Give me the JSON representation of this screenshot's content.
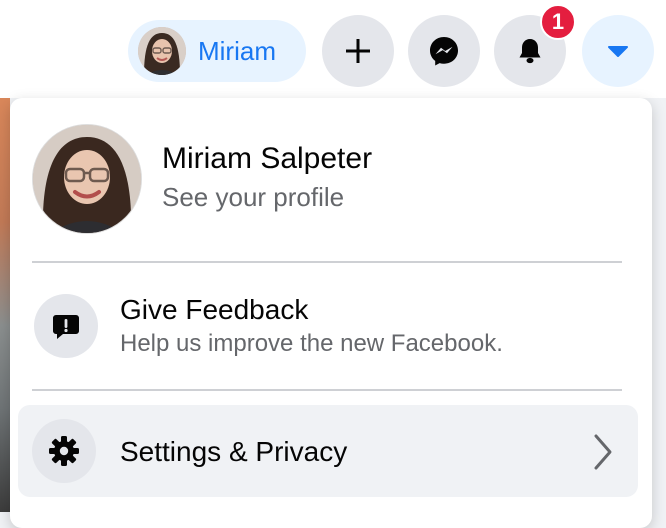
{
  "header": {
    "profile_chip_name": "Miriam",
    "notifications_count": "1",
    "buttons": {
      "create": "plus-icon",
      "messenger": "messenger-icon",
      "notifications": "bell-icon",
      "account": "caret-down-icon"
    }
  },
  "menu": {
    "profile": {
      "name": "Miriam Salpeter",
      "subtitle": "See your profile"
    },
    "items": [
      {
        "title": "Give Feedback",
        "subtitle": "Help us improve the new Facebook.",
        "icon": "feedback-icon"
      },
      {
        "title": "Settings & Privacy",
        "icon": "gear-icon",
        "trailing_icon": "chevron-right-icon"
      }
    ]
  },
  "colors": {
    "accent": "#1877f2",
    "badge": "#e41e3f",
    "icon_bg": "#e4e6eb",
    "hover_bg": "#f0f2f5"
  }
}
